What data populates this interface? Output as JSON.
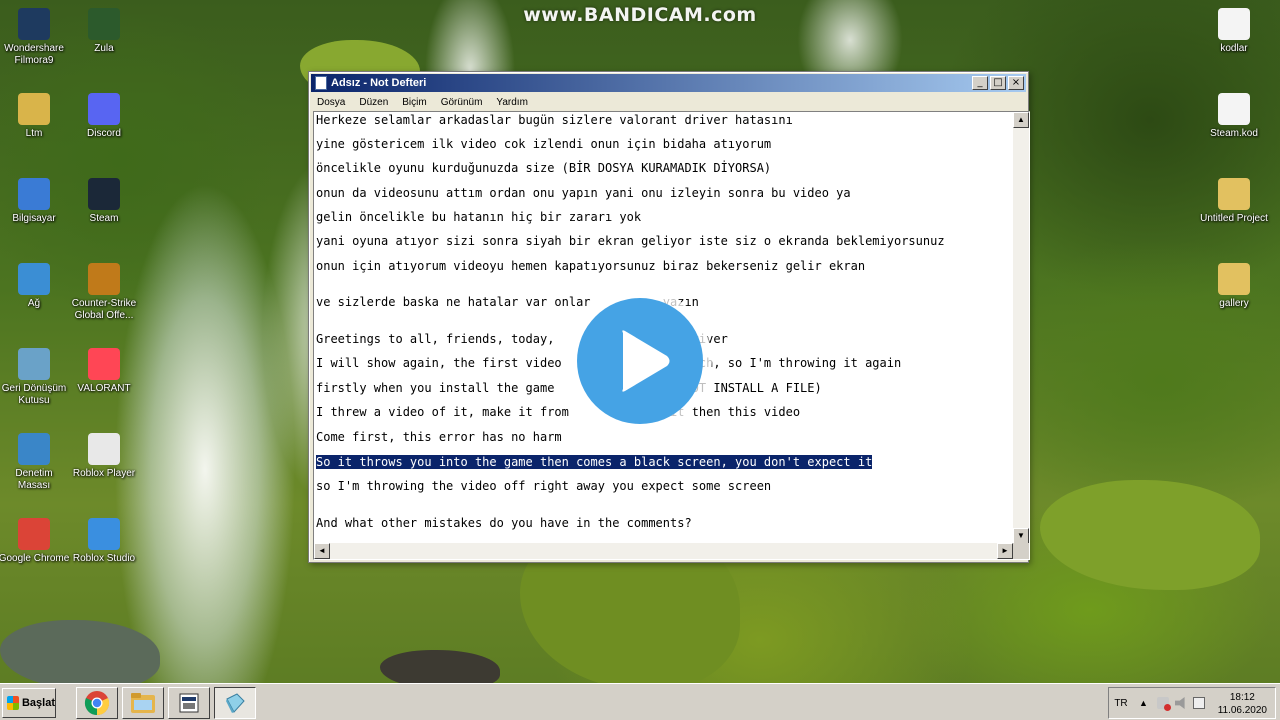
{
  "watermark": "www.BANDICAM.com",
  "desktop": {
    "left_icons": [
      {
        "label": "Wondershare Filmora9",
        "icon": "filmora-icon",
        "color": "#1e3a5f"
      },
      {
        "label": "Zula",
        "icon": "zula-icon",
        "color": "#2c5a2c"
      },
      {
        "label": "Ltm",
        "icon": "folder-icon",
        "color": "#d9b44a"
      },
      {
        "label": "Discord",
        "icon": "discord-icon",
        "color": "#5865f2"
      },
      {
        "label": "Bilgisayar",
        "icon": "computer-icon",
        "color": "#3a7bd5"
      },
      {
        "label": "Steam",
        "icon": "steam-icon",
        "color": "#1b2838"
      },
      {
        "label": "Ağ",
        "icon": "network-icon",
        "color": "#3b8ed4"
      },
      {
        "label": "Counter-Strike Global Offe...",
        "icon": "csgo-icon",
        "color": "#c07a1a"
      },
      {
        "label": "Geri Dönüşüm Kutusu",
        "icon": "recycle-bin-icon",
        "color": "#6aa2c8"
      },
      {
        "label": "VALORANT",
        "icon": "valorant-icon",
        "color": "#ff4655"
      },
      {
        "label": "Denetim Masası",
        "icon": "control-panel-icon",
        "color": "#3a86c8"
      },
      {
        "label": "Roblox Player",
        "icon": "roblox-icon",
        "color": "#e8e8e8"
      },
      {
        "label": "Google Chrome",
        "icon": "chrome-icon",
        "color": "#db4437"
      },
      {
        "label": "Roblox Studio",
        "icon": "roblox-studio-icon",
        "color": "#3a8fe0"
      }
    ],
    "right_icons": [
      {
        "label": "kodlar",
        "icon": "text-file-icon",
        "color": "#f4f4f4"
      },
      {
        "label": "Steam.kod",
        "icon": "text-file-icon",
        "color": "#f4f4f4"
      },
      {
        "label": "Untitled Project",
        "icon": "folder-icon",
        "color": "#e2c160"
      },
      {
        "label": "gallery",
        "icon": "folder-icon",
        "color": "#e2c160"
      }
    ]
  },
  "notepad": {
    "title": "Adsız - Not Defteri",
    "menu": [
      "Dosya",
      "Düzen",
      "Biçim",
      "Görünüm",
      "Yardım"
    ],
    "lines": [
      "Herkeze selamlar arkadaslar bugün sizlere valorant driver hatasını",
      "yine göstericem ilk video cok izlendi onun için bidaha atıyorum",
      "öncelikle oyunu kurduğunuzda size (BİR DOSYA KURAMADIK DİYORSA)",
      "onun da videosunu attım ordan onu yapın yani onu izleyin sonra bu video ya",
      "gelin öncelikle bu hatanın hiç bir zararı yok",
      "yani oyuna atıyor sizi sonra siyah bir ekran geliyor iste siz o ekranda beklemiyorsunuz",
      "onun için atıyorum videoyu hemen kapatıyorsunuz biraz bekerseniz gelir ekran",
      "ve sizlerde baska ne hatalar var onlar          yazın",
      "Greetings to all, friends, today,                  driver",
      "I will show again, the first video                  uch, so I'm throwing it again",
      "firstly when you install the game                  NOT INSTALL A FILE)",
      "I threw a video of it, make it from              it then this video",
      "Come first, this error has no harm",
      "So it throws you into the game then comes a black screen, you don't expect it",
      "so I'm throwing the video off right away you expect some screen",
      "And what other mistakes do you have in the comments?"
    ],
    "selected_line_index": 13
  },
  "overlay": {
    "icon": "play-icon"
  },
  "taskbar": {
    "start_label": "Başlat",
    "buttons": [
      {
        "icon": "chrome-icon"
      },
      {
        "icon": "explorer-icon"
      },
      {
        "icon": "media-icon"
      },
      {
        "icon": "notepad-icon"
      }
    ],
    "tray": {
      "language": "TR",
      "icons": [
        "chevron-up-icon",
        "network-error-icon",
        "volume-icon",
        "notification-icon"
      ]
    },
    "clock": {
      "time": "18:12",
      "date": "11.06.2020"
    }
  }
}
